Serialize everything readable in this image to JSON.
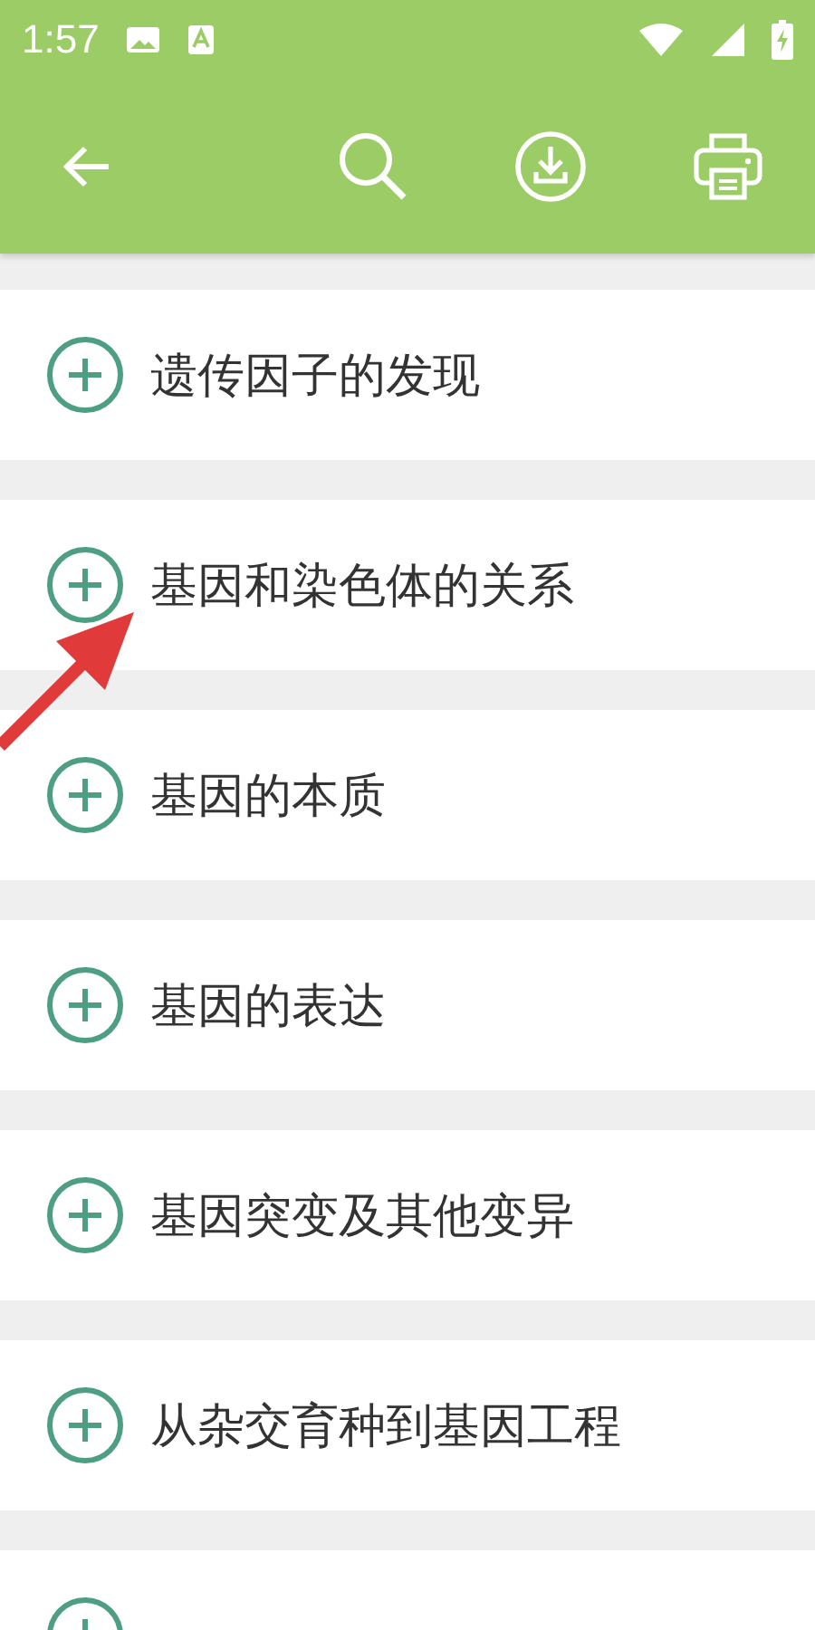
{
  "status_bar": {
    "time": "1:57"
  },
  "chapters": [
    {
      "title": "遗传因子的发现",
      "expanded": false
    },
    {
      "title": "基因和染色体的关系",
      "expanded": false
    },
    {
      "title": "基因的本质",
      "expanded": false
    },
    {
      "title": "基因的表达",
      "expanded": false
    },
    {
      "title": "基因突变及其他变异",
      "expanded": false
    },
    {
      "title": "从杂交育种到基因工程",
      "expanded": false
    },
    {
      "expanded": false
    }
  ]
}
